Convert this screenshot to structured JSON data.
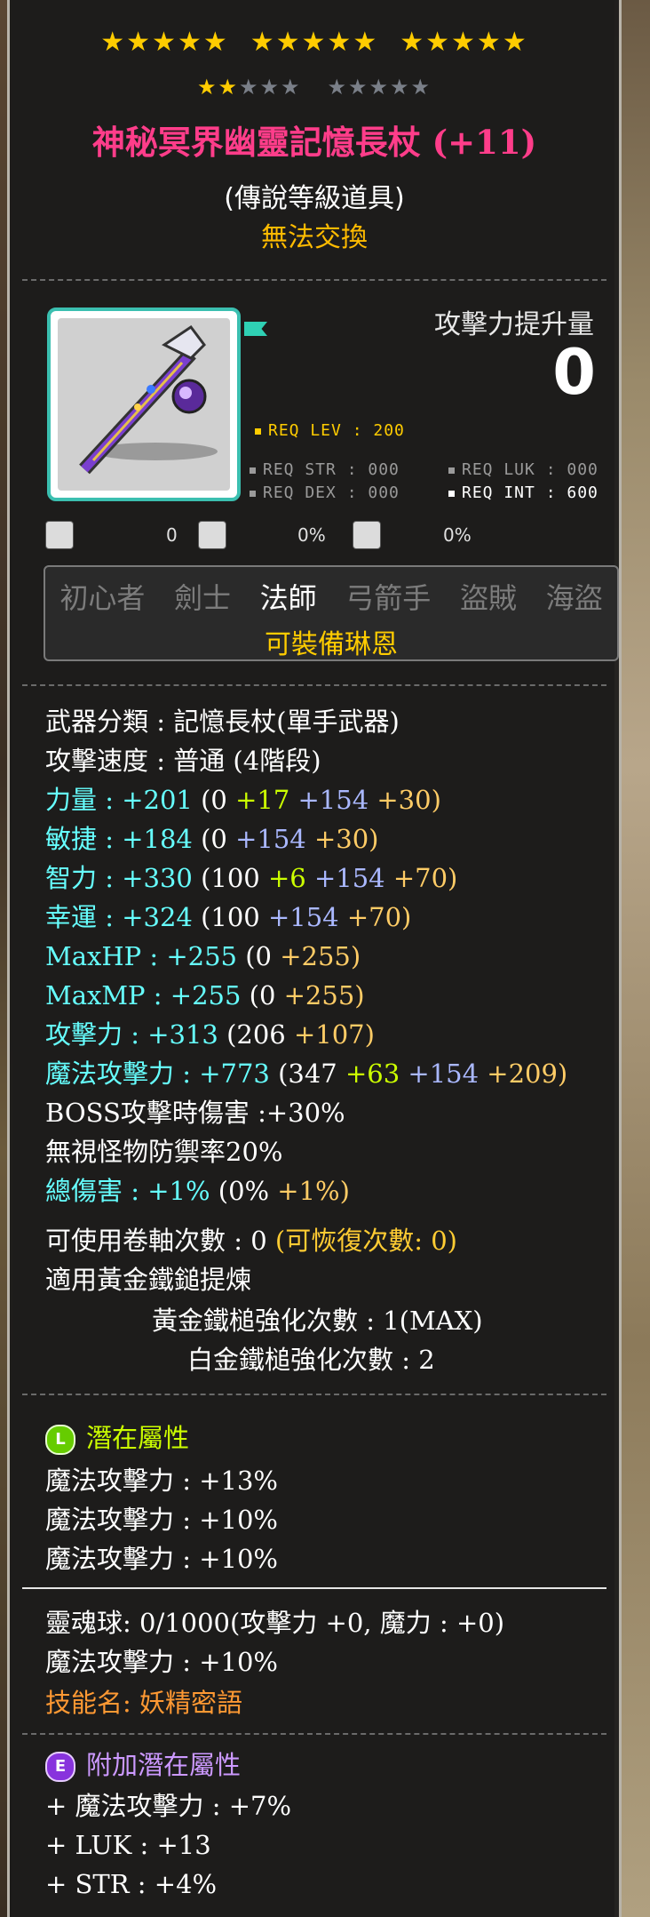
{
  "stars_row1": [
    "★★★★★",
    "★★★★★",
    "★★★★★"
  ],
  "stars_row2_on": "★★",
  "stars_row2_off_a": "★★★",
  "stars_row2_off_b": "★★★★★",
  "item_name": "神秘冥界幽靈記憶長杖 (+11)",
  "grade": "(傳說等級道具)",
  "untradable": "無法交換",
  "attack_increase_label": "攻擊力提升量",
  "attack_increase_value": "0",
  "requirements": {
    "lev": "REQ LEV : 200",
    "str": "REQ STR : 000",
    "dex": "REQ DEX : 000",
    "luk": "REQ LUK : 000",
    "int": "REQ INT : 600"
  },
  "misc": {
    "a": "0",
    "b": "0%",
    "c": "0%"
  },
  "jobs": [
    "初心者",
    "劍士",
    "法師",
    "弓箭手",
    "盜賊",
    "海盜"
  ],
  "active_job": "法師",
  "equip_note": "可裝備琳恩",
  "stats": {
    "weapon_type": "武器分類 : 記憶長杖(單手武器)",
    "attack_speed": "攻擊速度 : 普通 (4階段)",
    "str": {
      "label": "力量 :",
      "total": "+201",
      "base": "(0",
      "a": "+17",
      "b": "+154",
      "c": "+30)"
    },
    "dex": {
      "label": "敏捷 :",
      "total": "+184",
      "base": "(0",
      "b": "+154",
      "c": "+30)"
    },
    "int": {
      "label": "智力 :",
      "total": "+330",
      "base": "(100",
      "a": "+6",
      "b": "+154",
      "c": "+70)"
    },
    "luk": {
      "label": "幸運 :",
      "total": "+324",
      "base": "(100",
      "b": "+154",
      "c": "+70)"
    },
    "maxhp": {
      "label": "MaxHP :",
      "total": "+255",
      "base": "(0",
      "c": "+255)"
    },
    "maxmp": {
      "label": "MaxMP :",
      "total": "+255",
      "base": "(0",
      "c": "+255)"
    },
    "atk": {
      "label": "攻擊力 :",
      "total": "+313",
      "base": "(206",
      "c": "+107)"
    },
    "matk": {
      "label": "魔法攻擊力 :",
      "total": "+773",
      "base": "(347",
      "a": "+63",
      "b": "+154",
      "c": "+209)"
    },
    "boss": "BOSS攻擊時傷害 :+30%",
    "ignore_def": "無視怪物防禦率20%",
    "total_dmg": {
      "label": "總傷害 :",
      "total": "+1%",
      "base": "(0%",
      "c": "+1%)"
    },
    "upgrades": "可使用卷軸次數 : 0",
    "upgrades_restore": "(可恢復次數: 0)",
    "golden_hammer": "適用黃金鐵鎚提煉",
    "golden_hammer_count": "黃金鐵槌強化次數 : 1(MAX)",
    "platinum_hammer_count": "白金鐵槌強化次數 : 2"
  },
  "potential": {
    "badge": "L",
    "title": "潛在屬性",
    "lines": [
      "魔法攻擊力 : +13%",
      "魔法攻擊力 : +10%",
      "魔法攻擊力 : +10%"
    ]
  },
  "soul": {
    "line": "靈魂球: 0/1000(攻擊力 +0, 魔力 : +0)",
    "effect": "魔法攻擊力 : +10%",
    "skill": "技能名: 妖精密語"
  },
  "bonus_potential": {
    "badge": "E",
    "title": "附加潛在屬性",
    "lines": [
      "+ 魔法攻擊力 : +7%",
      "+ LUK : +13",
      "+ STR : +4%"
    ]
  },
  "colors": {
    "title": "#ff3d8a",
    "gold": "#ffcc00",
    "cyan": "#66ffff",
    "frame": "#3bbfb0"
  }
}
